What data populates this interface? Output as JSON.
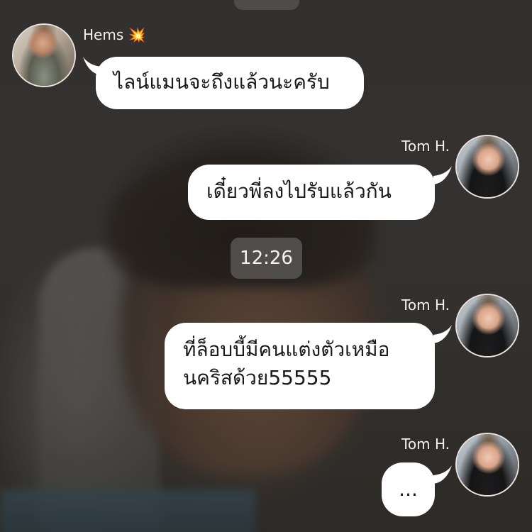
{
  "chat": {
    "timestamp": "12:26",
    "messages": [
      {
        "sender": "Hems",
        "sender_emoji": "💥",
        "text": "ไลน์แมนจะถึงแล้วนะครับ"
      },
      {
        "sender": "Tom H.",
        "text": "เดี๋ยวพี่ลงไปรับแล้วกัน"
      },
      {
        "sender": "Tom H.",
        "lines": [
          "ที่ล็อบบี้มีคนแต่งตัวเหมือ",
          "นคริสด้วย55555"
        ]
      },
      {
        "sender": "Tom H.",
        "text": "..."
      }
    ]
  },
  "colors": {
    "bubble": "#ffffff",
    "bubble_text": "#1a1a1a",
    "name_text": "#f4f1ec",
    "badge_bg": "#585654"
  },
  "icons": {
    "sender_badge": "collision-emoji"
  }
}
